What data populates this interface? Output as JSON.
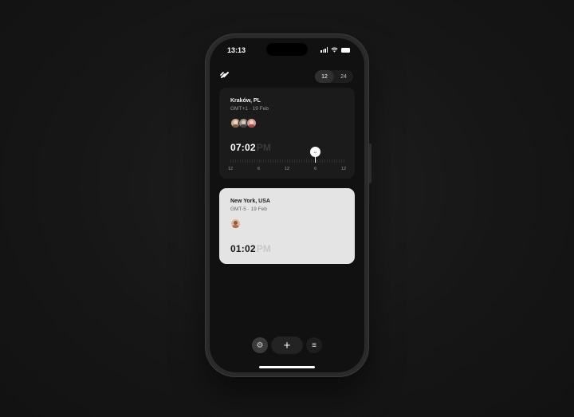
{
  "status": {
    "time": "13:13"
  },
  "header": {
    "logo_icon": "sunrise-logo-icon",
    "format_options": [
      "12",
      "24"
    ],
    "format_selected": "12"
  },
  "cards": [
    {
      "city": "Kraków, PL",
      "meta": "GMT+1 · 19 Feb",
      "time": "07:02",
      "ampm": "PM",
      "timeline_labels": [
        "12",
        "6",
        "12",
        "6",
        "12"
      ],
      "scrubber_label": "↔",
      "current_position_fraction": 0.74
    },
    {
      "city": "New York, USA",
      "meta": "GMT-5 · 19 Feb",
      "time": "01:02",
      "ampm": "PM"
    }
  ],
  "bottom_bar": {
    "settings_icon": "⚙",
    "add_icon": "+",
    "menu_icon": "≡"
  },
  "colors": {
    "background": "#161616",
    "card_dark": "#1b1b1b",
    "card_light": "#e4e4e4",
    "accent": "#ffffff"
  }
}
